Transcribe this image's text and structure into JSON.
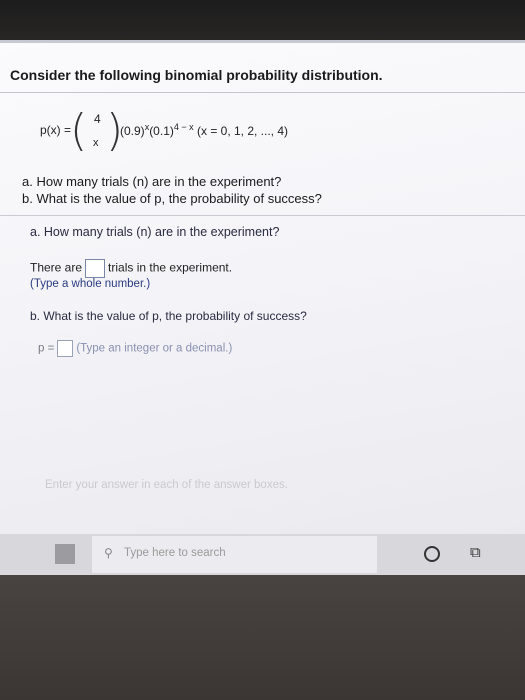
{
  "question": {
    "title": "Consider the following binomial probability distribution.",
    "formula": {
      "lhs": "p(x) =",
      "binom_top": "4",
      "binom_bottom": "x",
      "term1": "(0.9)",
      "exp1": "x",
      "term2": "(0.1)",
      "exp2": "4 − x",
      "domain": "(x = 0, 1, 2, ..., 4)"
    },
    "part_a": "a. How many trials (n) are in the experiment?",
    "part_b": "b. What is the value of p, the probability of success?"
  },
  "answer_a": {
    "label": "a. How many trials (n) are in the experiment?",
    "prefix": "There are",
    "suffix": "trials in the experiment.",
    "hint": "(Type a whole number.)",
    "value": ""
  },
  "answer_b": {
    "label": "b. What is the value of p, the probability of success?",
    "prefix": "p =",
    "hint": "(Type an integer or a decimal.)",
    "value": ""
  },
  "footer": {
    "instruction": "Enter your answer in each of the answer boxes."
  },
  "taskbar": {
    "search_placeholder": "Type here to search"
  }
}
